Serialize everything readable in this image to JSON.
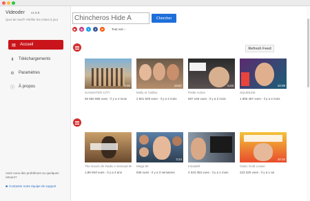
{
  "window": {
    "title": ""
  },
  "sidebar": {
    "brand": "Videoder",
    "version": "v1.0.9",
    "tagline": "Quoi de neuf? Vérifier les mises à jour",
    "items": [
      {
        "label": "Accueil",
        "icon": "home-icon",
        "active": true
      },
      {
        "label": "Téléchargements",
        "icon": "download-icon",
        "active": false
      },
      {
        "label": "Paramètres",
        "icon": "gear-icon",
        "active": false
      },
      {
        "label": "À propos",
        "icon": "info-icon",
        "active": false
      }
    ],
    "help_text": "Avez-vous des problèmes ou quelques retours?",
    "contact_label": "Contacter notre équipe de support"
  },
  "search": {
    "value": "Chincheros Hide A",
    "button_label": "Chercher",
    "see_all": "Tout voir ›"
  },
  "sources": [
    {
      "name": "youtube",
      "color": "#d32f2f"
    },
    {
      "name": "instagram",
      "color": "#c13584"
    },
    {
      "name": "twitter",
      "color": "#1da1f2"
    },
    {
      "name": "facebook",
      "color": "#3b5998"
    },
    {
      "name": "soundcloud",
      "color": "#ff5500"
    }
  ],
  "feed": {
    "refresh_label": "Refresh Feed",
    "rows": [
      [
        {
          "title": "GANGSTER CITY",
          "meta": "55 582 885 vues - il y a 4 mois",
          "duration": "4:00"
        },
        {
          "title": "Molly et Caillou",
          "meta": "2 801 829 vues - il y a 4 mois",
          "duration": "13:57"
        },
        {
          "title": "Petite Action",
          "meta": "587 246 vues - il y a 2 mois",
          "duration": "6:23"
        },
        {
          "title": "SQUEEZIE",
          "meta": "1 855 487 vues - il y a 4 mois",
          "duration": "10:09"
        }
      ],
      [
        {
          "title": "The Good Life Radio x Sensual Musiq",
          "meta": "1,88 Mrd vues - il y a 3 ans",
          "duration": ""
        },
        {
          "title": "Mega 80",
          "meta": "836 vues - il y a 3 semaines",
          "duration": "3:24"
        },
        {
          "title": "Inmadell",
          "meta": "4 023 353 vues - il y a 1 mois",
          "duration": ""
        },
        {
          "title": "Oasis Gold Louise",
          "meta": "223 320 vues - il y a 1 an",
          "duration": "10:10"
        }
      ]
    ]
  }
}
